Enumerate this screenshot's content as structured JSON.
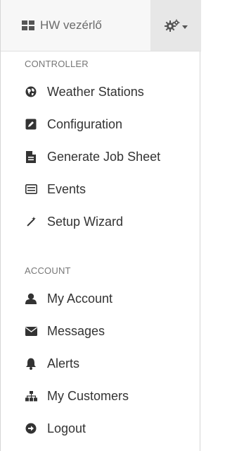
{
  "navbar": {
    "brand_label": "HW vezérlő",
    "brand_icon": "grid-icon",
    "settings_icon": "cogs-icon"
  },
  "menu": {
    "controller_header": "CONTROLLER",
    "controller_items": [
      {
        "label": "Weather Stations",
        "icon": "globe-icon"
      },
      {
        "label": "Configuration",
        "icon": "edit-icon"
      },
      {
        "label": "Generate Job Sheet",
        "icon": "file-icon"
      },
      {
        "label": "Events",
        "icon": "list-icon"
      },
      {
        "label": "Setup Wizard",
        "icon": "magic-wand-icon"
      }
    ],
    "account_header": "ACCOUNT",
    "account_items": [
      {
        "label": "My Account",
        "icon": "user-icon"
      },
      {
        "label": "Messages",
        "icon": "envelope-icon"
      },
      {
        "label": "Alerts",
        "icon": "bell-icon"
      },
      {
        "label": "My Customers",
        "icon": "sitemap-icon"
      },
      {
        "label": "Logout",
        "icon": "logout-icon"
      }
    ]
  }
}
